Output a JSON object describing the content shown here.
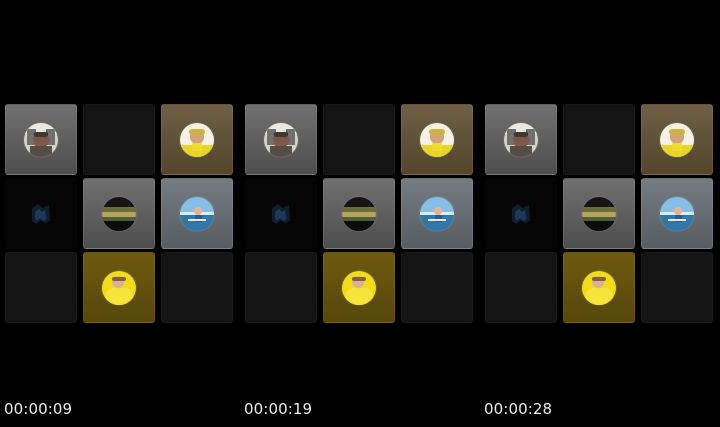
{
  "gallery": {
    "panels": [
      {
        "timestamp": "00:00:09"
      },
      {
        "timestamp": "00:00:19"
      },
      {
        "timestamp": "00:00:28"
      }
    ]
  }
}
